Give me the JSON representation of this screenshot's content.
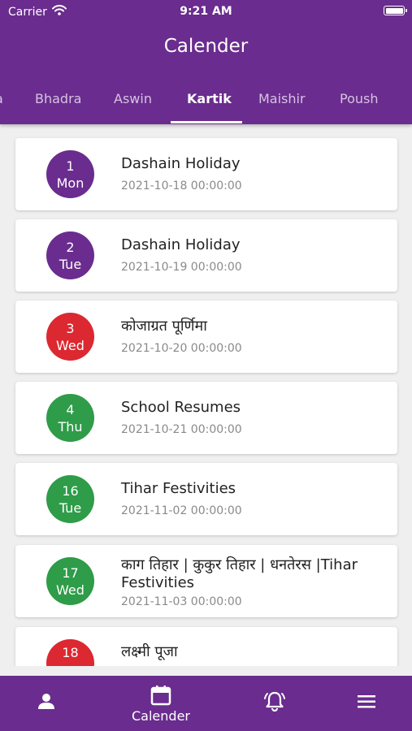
{
  "status": {
    "carrier": "Carrier",
    "time": "9:21 AM"
  },
  "header": {
    "title": "Calender"
  },
  "tabs": [
    {
      "label": "Bhadra"
    },
    {
      "label": "Aswin"
    },
    {
      "label": "Kartik",
      "active": true
    },
    {
      "label": "Maishir"
    },
    {
      "label": "Poush"
    }
  ],
  "events": [
    {
      "day": "1",
      "weekday": "Mon",
      "title": "Dashain Holiday",
      "date": "2021-10-18 00:00:00",
      "color": "#6a2c8e"
    },
    {
      "day": "2",
      "weekday": "Tue",
      "title": "Dashain Holiday",
      "date": "2021-10-19 00:00:00",
      "color": "#6a2c8e"
    },
    {
      "day": "3",
      "weekday": "Wed",
      "title": "कोजाग्रत पूर्णिमा",
      "date": "2021-10-20 00:00:00",
      "color": "#dc2830"
    },
    {
      "day": "4",
      "weekday": "Thu",
      "title": "School Resumes",
      "date": "2021-10-21 00:00:00",
      "color": "#2e9c48"
    },
    {
      "day": "16",
      "weekday": "Tue",
      "title": "Tihar Festivities",
      "date": "2021-11-02 00:00:00",
      "color": "#2e9c48"
    },
    {
      "day": "17",
      "weekday": "Wed",
      "title": "काग तिहार | कुकुर तिहार | धनतेरस |Tihar Festivities",
      "date": "2021-11-03 00:00:00",
      "color": "#2e9c48"
    },
    {
      "day": "18",
      "weekday": "",
      "title": "लक्ष्मी पूजा",
      "date": "",
      "color": "#dc2830"
    }
  ],
  "bottom_nav": {
    "calendar_label": "Calender",
    "icons": [
      "profile-icon",
      "calendar-icon",
      "bell-icon",
      "menu-icon"
    ]
  },
  "colors": {
    "primary": "#6a2c8e",
    "holiday": "#dc2830",
    "event": "#2e9c48"
  }
}
